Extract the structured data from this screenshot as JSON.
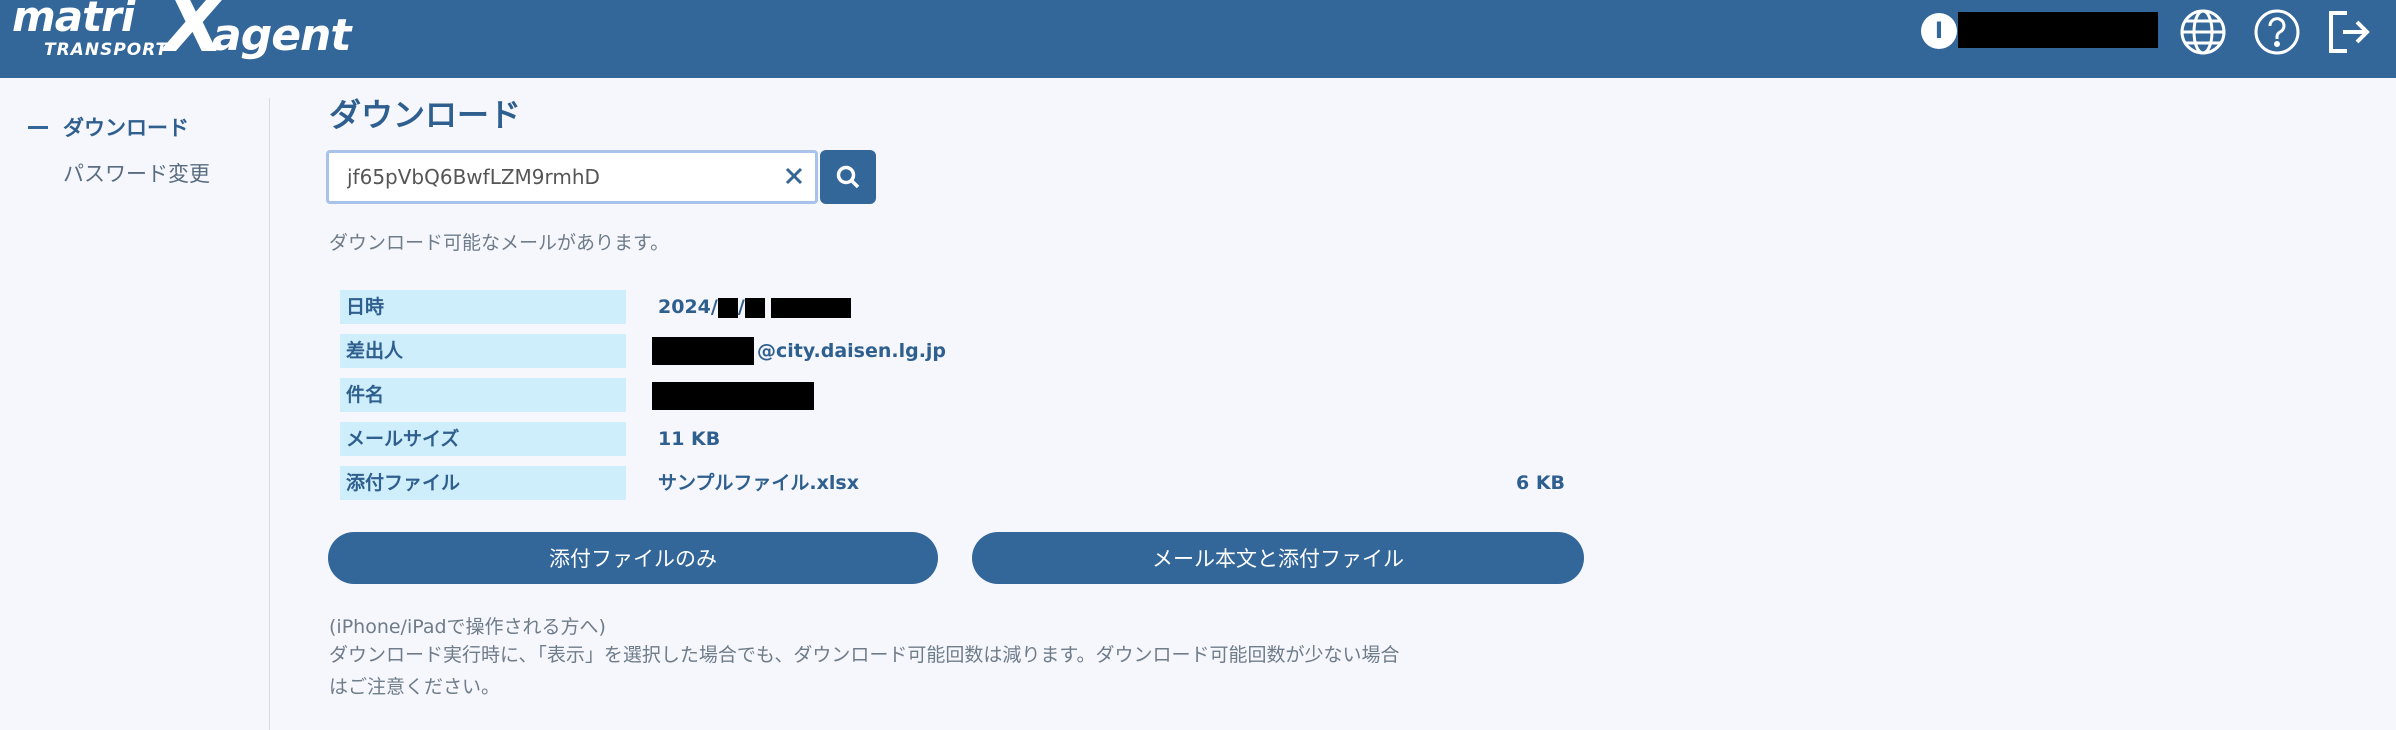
{
  "header": {
    "logo_matri": "matri",
    "logo_x": "X",
    "logo_agent": "agent",
    "logo_transport": "TRANSPORT",
    "user_initial": "I",
    "icons": [
      "globe-icon",
      "help-icon",
      "logout-icon"
    ]
  },
  "sidebar": {
    "items": [
      {
        "label": "ダウンロード",
        "active": true
      },
      {
        "label": "パスワード変更",
        "active": false
      }
    ]
  },
  "main": {
    "title": "ダウンロード",
    "search": {
      "value": "jf65pVbQ6BwfLZM9rmhD",
      "clear_symbol": "×"
    },
    "available_message": "ダウンロード可能なメールがあります。",
    "info": {
      "date_label": "日時",
      "date_value_prefix": "2024/",
      "date_sep": "/",
      "sender_label": "差出人",
      "sender_value": "@city.daisen.lg.jp",
      "subject_label": "件名",
      "size_label": "メールサイズ",
      "size_value": "11 KB",
      "attachment_label": "添付ファイル",
      "attachment_name": "サンプルファイル.xlsx",
      "attachment_size": "6 KB"
    },
    "buttons": {
      "attachment_only": "添付ファイルのみ",
      "body_and_attachment": "メール本文と添付ファイル"
    },
    "notes": [
      "(iPhone/iPadで操作される方へ)",
      "ダウンロード実行時に、「表示」を選択した場合でも、ダウンロード可能回数は減ります。ダウンロード可能回数が少ない場合",
      "はご注意ください。"
    ]
  },
  "colors": {
    "header_bg": "#336699",
    "label_bg": "#cfeefb",
    "button_bg": "#336699",
    "page_bg": "#f5f7fc"
  }
}
